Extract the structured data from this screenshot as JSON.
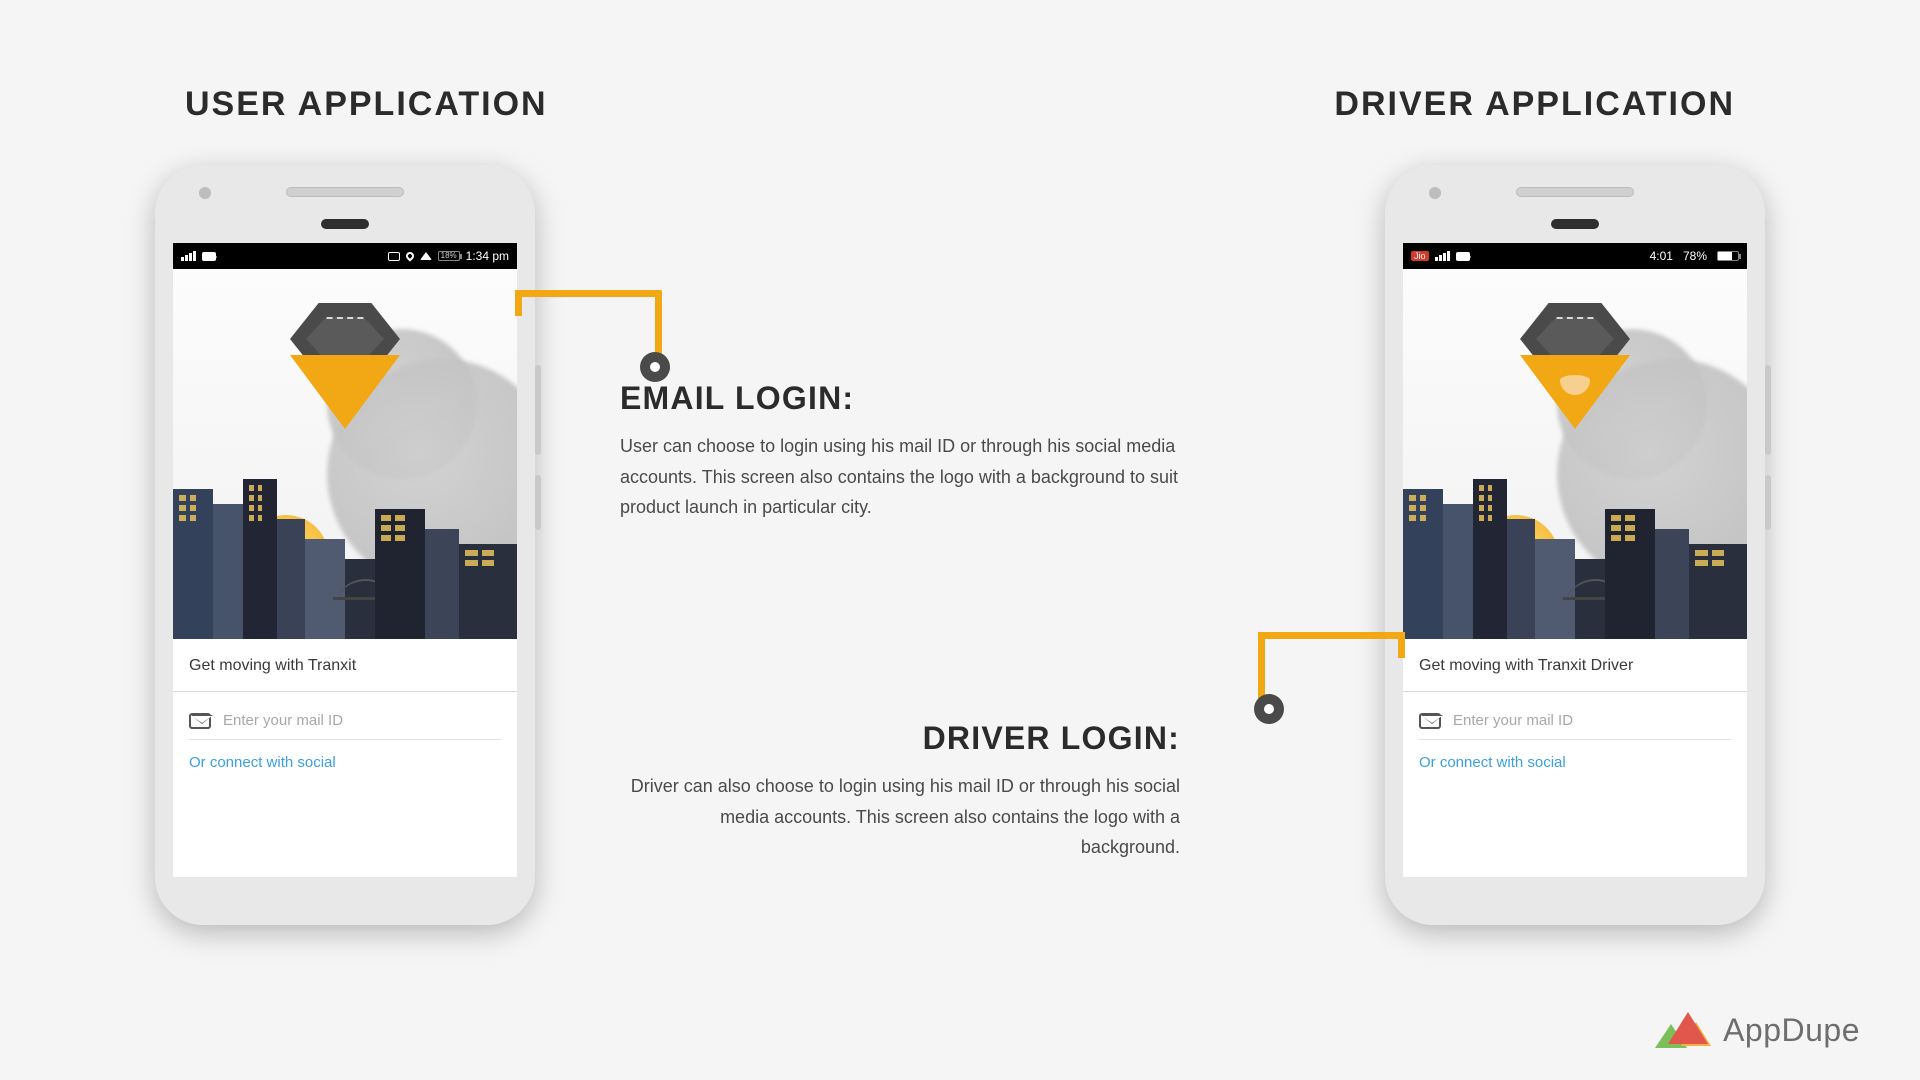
{
  "headings": {
    "left": "USER APPLICATION",
    "right": "DRIVER APPLICATION"
  },
  "user_phone": {
    "status": {
      "time": "1:34 pm",
      "battery": "18%"
    },
    "tagline": "Get moving with Tranxit",
    "email_placeholder": "Enter your mail ID",
    "social_link": "Or connect with social"
  },
  "driver_phone": {
    "status": {
      "time": "4:01",
      "carrier": "Jio",
      "battery": "78%"
    },
    "tagline": "Get moving with Tranxit Driver",
    "email_placeholder": "Enter your mail ID",
    "social_link": "Or connect with social"
  },
  "callouts": {
    "email": {
      "title": "EMAIL LOGIN:",
      "body": "User can choose to login using his mail ID or through his social media accounts. This screen also contains the logo with a background to suit product launch in particular city."
    },
    "driver": {
      "title": "DRIVER LOGIN:",
      "body": "Driver can also choose to login using his mail ID or through his social media accounts. This screen also contains the logo with a background."
    }
  },
  "brand": "AppDupe"
}
